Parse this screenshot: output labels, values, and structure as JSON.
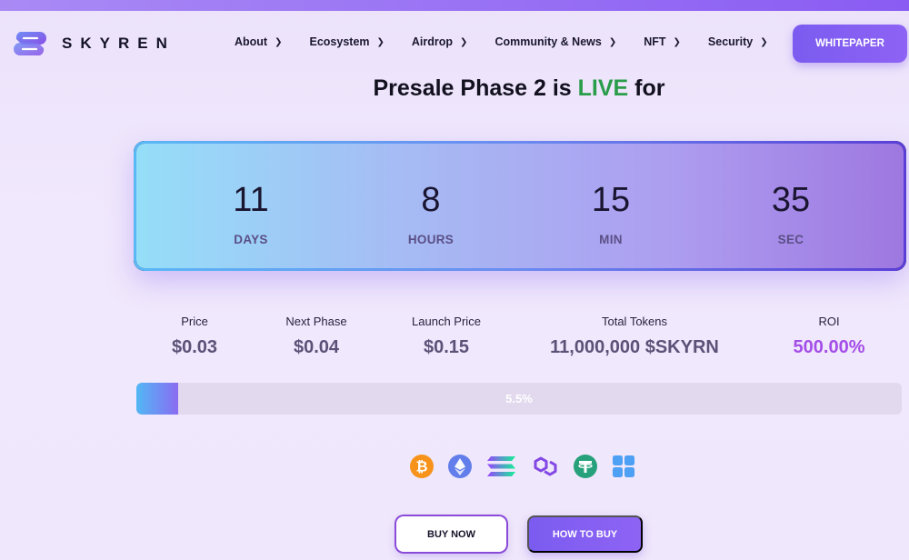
{
  "brand": {
    "name": "SKYREN",
    "logo_icon": "skyren-logo-icon"
  },
  "nav": [
    {
      "label": "About"
    },
    {
      "label": "Ecosystem"
    },
    {
      "label": "Airdrop"
    },
    {
      "label": "Community & News"
    },
    {
      "label": "NFT"
    },
    {
      "label": "Security"
    }
  ],
  "header": {
    "whitepaper_label": "WHITEPAPER"
  },
  "headline": {
    "prefix": "Presale Phase 2 is ",
    "highlight": "LIVE",
    "suffix": " for"
  },
  "countdown": [
    {
      "value": "11",
      "label": "DAYS"
    },
    {
      "value": "8",
      "label": "HOURS"
    },
    {
      "value": "15",
      "label": "MIN"
    },
    {
      "value": "35",
      "label": "SEC"
    }
  ],
  "stats": [
    {
      "label": "Price",
      "value": "$0.03"
    },
    {
      "label": "Next Phase",
      "value": "$0.04"
    },
    {
      "label": "Launch Price",
      "value": "$0.15"
    },
    {
      "label": "Total Tokens",
      "value": "11,000,000 $SKYRN"
    },
    {
      "label": "ROI",
      "value": "500.00%"
    }
  ],
  "progress": {
    "text": "5.5%",
    "fraction": 0.055
  },
  "coins": [
    "bitcoin-icon",
    "ethereum-icon",
    "solana-icon",
    "polygon-icon",
    "tether-icon",
    "bnb-grid-icon"
  ],
  "actions": {
    "buy_now": "BUY NOW",
    "how_to_buy": "HOW TO BUY"
  },
  "colors": {
    "accent": "#7b5cf0",
    "live": "#2a9d4a",
    "roi": "#a44ee8"
  }
}
